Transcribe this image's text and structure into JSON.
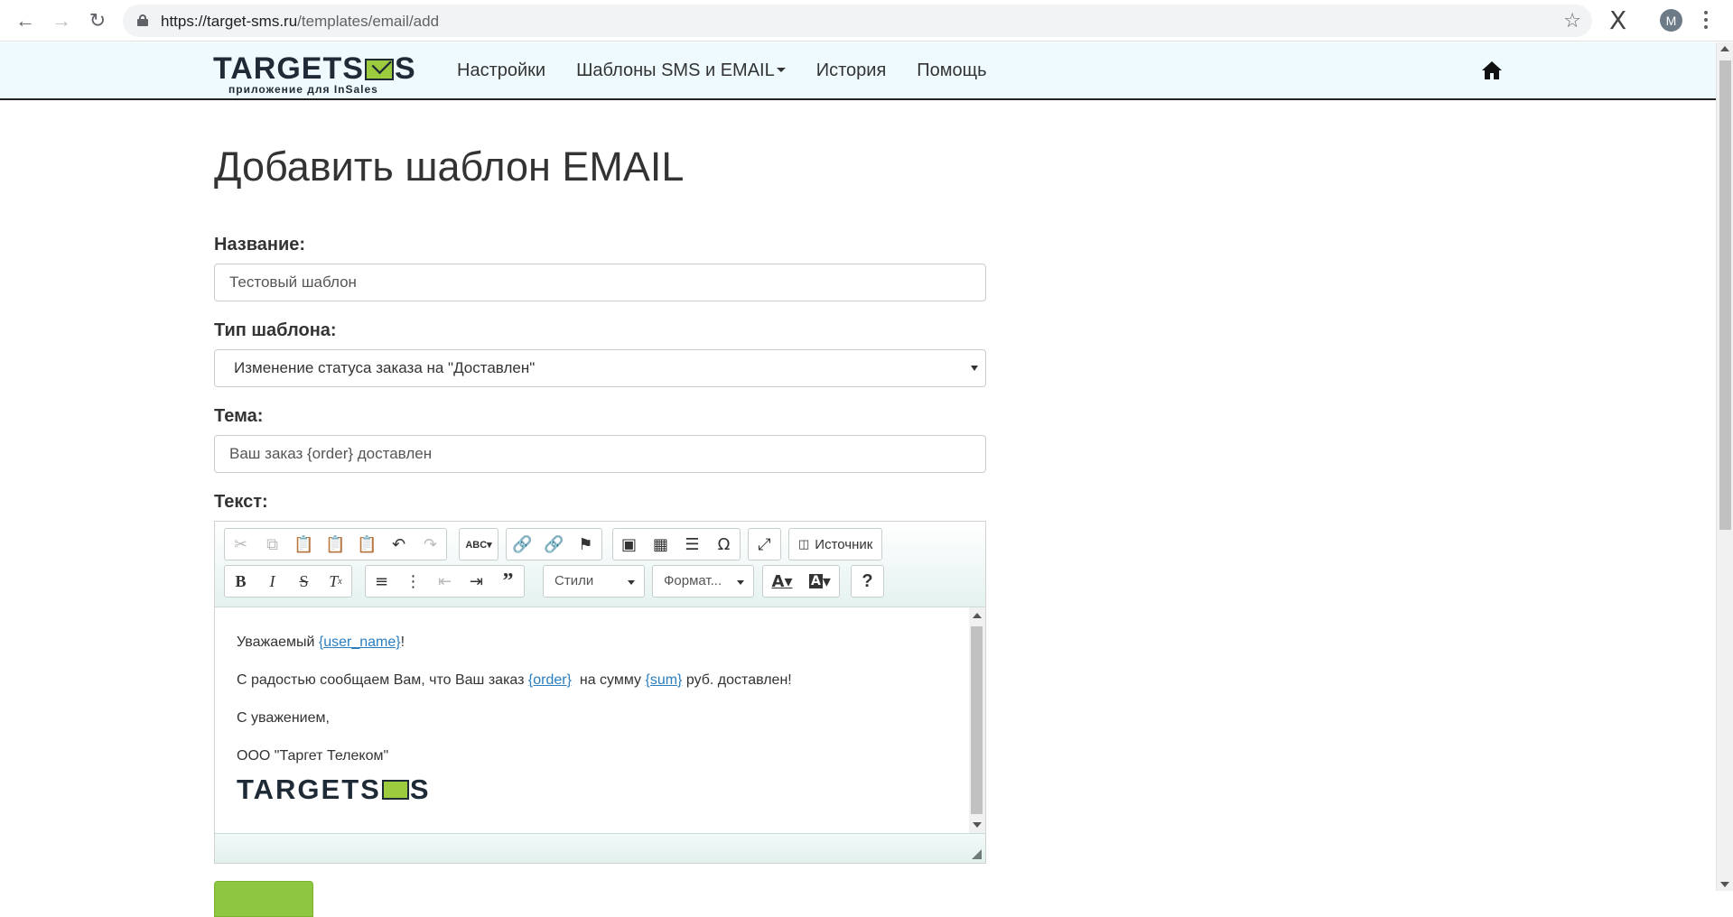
{
  "browser": {
    "url_host": "https://target-sms.ru",
    "url_path": "/templates/email/add",
    "avatar_letter": "M"
  },
  "nav": {
    "brand_word_left": "TARGETS",
    "brand_word_right": "S",
    "brand_sub": "приложение для InSales",
    "items": [
      "Настройки",
      "Шаблоны SMS и EMAIL",
      "История",
      "Помощь"
    ]
  },
  "page": {
    "title": "Добавить шаблон EMAIL",
    "name_label": "Название:",
    "name_value": "Тестовый шаблон",
    "type_label": "Тип шаблона:",
    "type_value": "Изменение статуса заказа на \"Доставлен\"",
    "subject_label": "Тема:",
    "subject_value": "Ваш заказ {order} доставлен",
    "text_label": "Текст:"
  },
  "editor": {
    "source_label": "Источник",
    "styles_label": "Стили",
    "format_label": "Формат...",
    "line1_pre": "Уважаемый ",
    "line1_var": "{user_name}",
    "line1_post": "!",
    "line2_pre": "С радостью сообщаем Вам, что Ваш заказ ",
    "line2_var1": "{order}",
    "line2_mid": "  на сумму ",
    "line2_var2": "{sum}",
    "line2_post": " руб. доставлен!",
    "line3": "С уважением,",
    "line4": "ООО \"Таргет Телеком\"",
    "sig_left": "TARGETS",
    "sig_right": "S"
  },
  "colors": {
    "accent_green": "#8dc63f",
    "link_blue": "#2a7dbf",
    "nav_bg": "#eefafd"
  }
}
